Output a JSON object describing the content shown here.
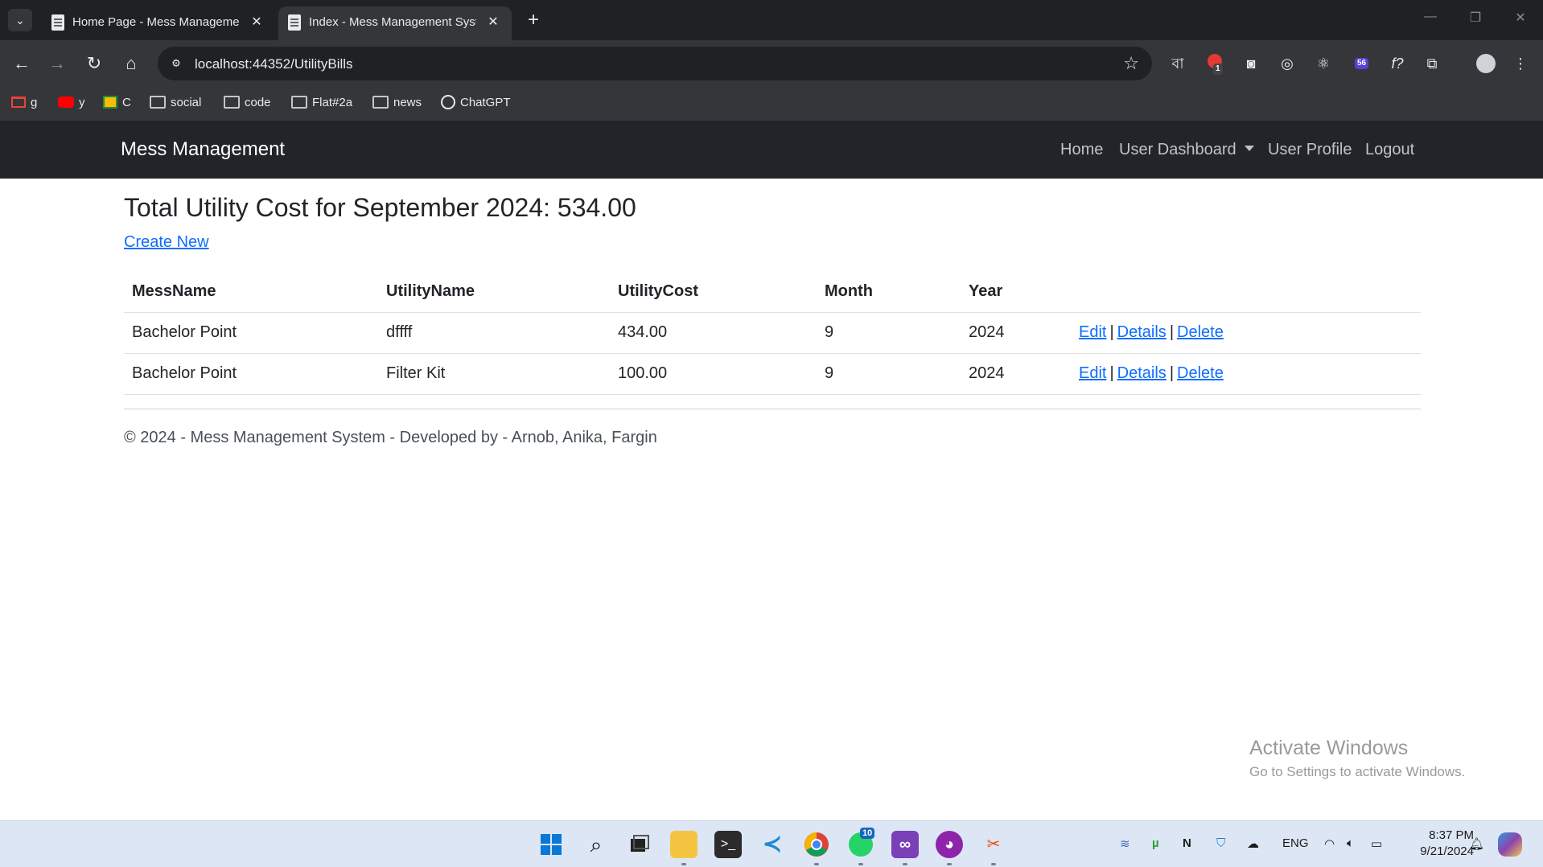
{
  "browser": {
    "tabs": [
      {
        "title": "Home Page - Mess Management"
      },
      {
        "title": "Index - Mess Management System"
      }
    ],
    "url": "localhost:44352/UtilityBills",
    "bookmarks": [
      {
        "label": "g",
        "icon": "gmail-icon"
      },
      {
        "label": "y",
        "icon": "youtube-icon"
      },
      {
        "label": "C",
        "icon": "classroom-icon"
      },
      {
        "label": "social",
        "icon": "folder-icon"
      },
      {
        "label": "code",
        "icon": "folder-icon"
      },
      {
        "label": "Flat#2a",
        "icon": "folder-icon"
      },
      {
        "label": "news",
        "icon": "folder-icon"
      },
      {
        "label": "ChatGPT",
        "icon": "chatgpt-icon"
      }
    ],
    "extensions": {
      "bangla_label": "বা",
      "red_badge": "1",
      "purple_badge": "56",
      "fx_label": "f?"
    }
  },
  "navbar": {
    "brand": "Mess Management",
    "links": {
      "home": "Home",
      "user_dashboard": "User Dashboard",
      "user_profile": "User Profile",
      "logout": "Logout"
    }
  },
  "main": {
    "title": "Total Utility Cost for September 2024: 534.00",
    "create_new": "Create New",
    "table": {
      "headers": [
        "MessName",
        "UtilityName",
        "UtilityCost",
        "Month",
        "Year",
        ""
      ],
      "rows": [
        {
          "mess": "Bachelor Point",
          "utility": "dffff",
          "cost": "434.00",
          "month": "9",
          "year": "2024"
        },
        {
          "mess": "Bachelor Point",
          "utility": "Filter Kit",
          "cost": "100.00",
          "month": "9",
          "year": "2024"
        }
      ],
      "actions": {
        "edit": "Edit",
        "details": "Details",
        "delete": "Delete",
        "separator": "|"
      }
    }
  },
  "footer": {
    "text": "© 2024 - Mess Management System - Developed by - Arnob, Anika, Fargin"
  },
  "watermark": {
    "line1": "Activate Windows",
    "line2": "Go to Settings to activate Windows."
  },
  "taskbar": {
    "whatsapp_badge": "10",
    "lang": "ENG",
    "time": "8:37 PM",
    "date": "9/21/2024"
  },
  "colors": {
    "navbar_bg": "#212529",
    "link": "#0d6efd",
    "chrome_dark": "#202124",
    "chrome_toolbar": "#35363a"
  }
}
